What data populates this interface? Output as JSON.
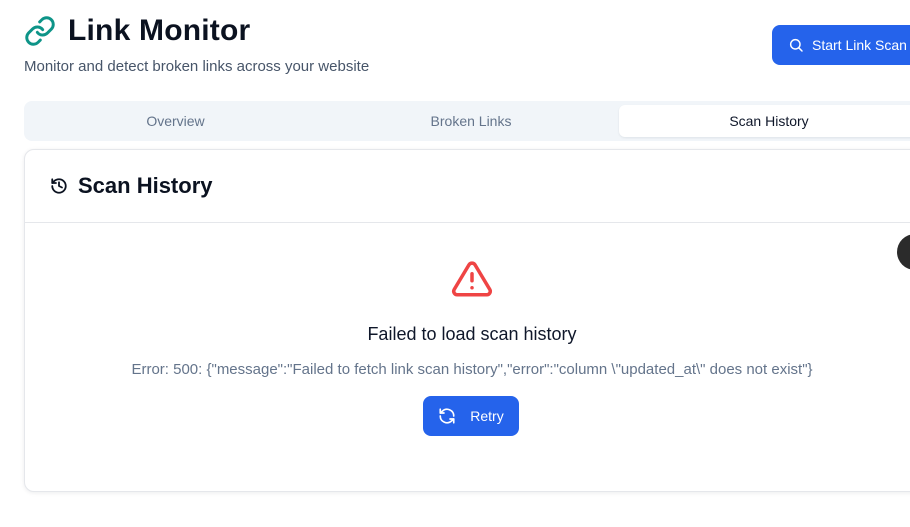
{
  "header": {
    "title": "Link Monitor",
    "subtitle": "Monitor and detect broken links across your website",
    "title_icon": "link-icon",
    "scan_button_label": "Start Link Scan",
    "scan_button_icon": "search-icon"
  },
  "tabs": [
    {
      "label": "Overview",
      "active": false
    },
    {
      "label": "Broken Links",
      "active": false
    },
    {
      "label": "Scan History",
      "active": true
    }
  ],
  "card": {
    "title": "Scan History",
    "title_icon": "history-icon",
    "error": {
      "icon": "alert-triangle-icon",
      "title": "Failed to load scan history",
      "message": "Error: 500: {\"message\":\"Failed to fetch link scan history\",\"error\":\"column \\\"updated_at\\\" does not exist\"}",
      "retry_label": "Retry",
      "retry_icon": "refresh-icon"
    }
  },
  "colors": {
    "accent": "#2563eb",
    "brand_icon": "#0d9488",
    "error": "#ef4444"
  }
}
